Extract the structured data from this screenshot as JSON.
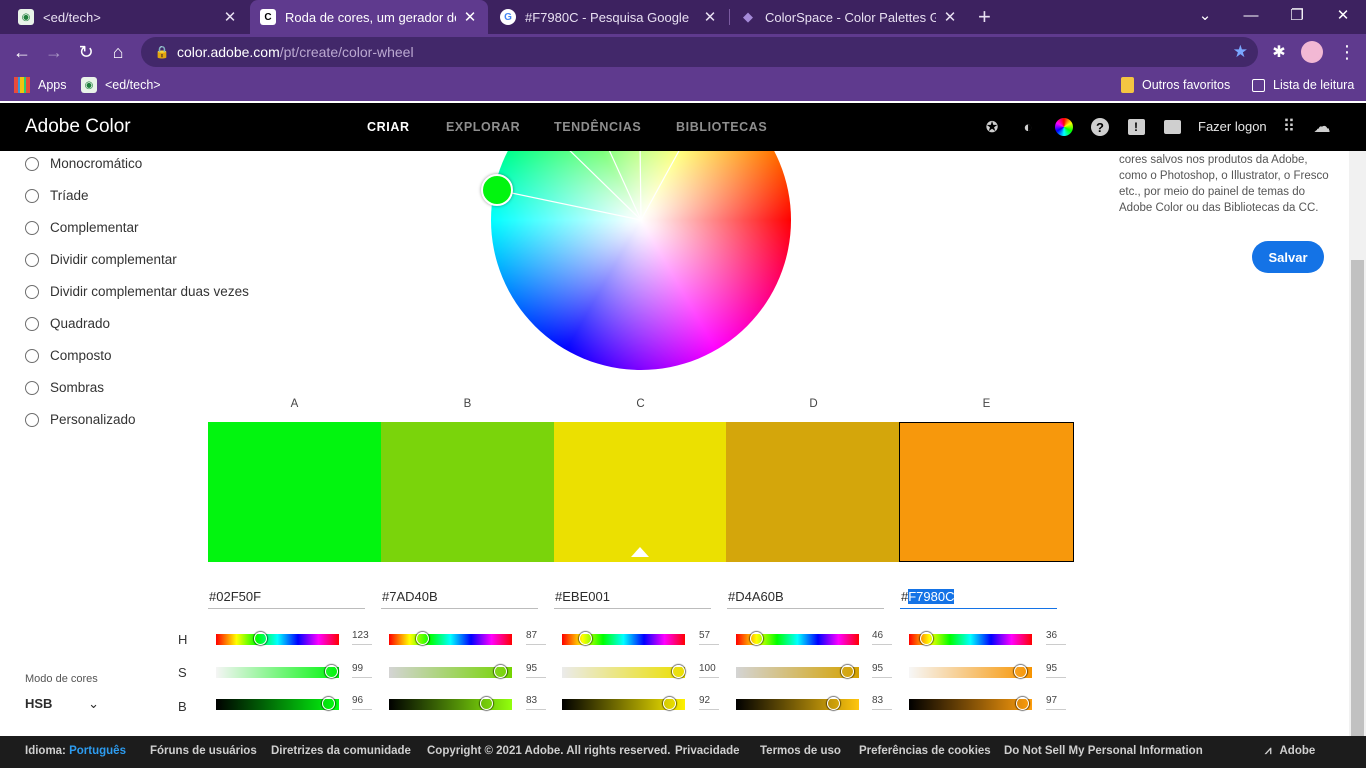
{
  "browser": {
    "tabs": [
      {
        "title": "<ed/tech>",
        "favicon": "edtech-icon",
        "active": false
      },
      {
        "title": "Roda de cores, um gerador de pa",
        "favicon": "adobe-color-icon",
        "active": true
      },
      {
        "title": "#F7980C - Pesquisa Google",
        "favicon": "google-icon",
        "active": false
      },
      {
        "title": "ColorSpace - Color Palettes Gene",
        "favicon": "colorspace-icon",
        "active": false
      }
    ],
    "new_tab": "+",
    "url_host": "color.adobe.com",
    "url_path": "/pt/create/color-wheel",
    "bookmarks": {
      "apps": "Apps",
      "edtech": "<ed/tech>",
      "other": "Outros favoritos",
      "reading_list": "Lista de leitura"
    }
  },
  "header": {
    "brand": "Adobe Color",
    "nav": [
      "CRIAR",
      "EXPLORAR",
      "TENDÊNCIAS",
      "BIBLIOTECAS"
    ],
    "active_nav": "CRIAR",
    "login": "Fazer logon"
  },
  "harmony_rules": [
    "Monocromático",
    "Tríade",
    "Complementar",
    "Dividir complementar",
    "Dividir complementar duas vezes",
    "Quadrado",
    "Composto",
    "Sombras",
    "Personalizado"
  ],
  "color_mode": {
    "label": "Modo de cores",
    "value": "HSB"
  },
  "save_panel": {
    "text": "cores salvos nos produtos da Adobe, como o Photoshop, o Illustrator, o Fresco etc., por meio do painel de temas do Adobe Color ou das Bibliotecas da CC.",
    "button": "Salvar"
  },
  "slider_labels": {
    "h": "H",
    "s": "S",
    "b": "B"
  },
  "swatches": [
    {
      "letter": "A",
      "hex": "#02F50F",
      "h": 123,
      "s": 99,
      "b": 96
    },
    {
      "letter": "B",
      "hex": "#7AD40B",
      "h": 87,
      "s": 95,
      "b": 83
    },
    {
      "letter": "C",
      "hex": "#EBE001",
      "h": 57,
      "s": 100,
      "b": 92
    },
    {
      "letter": "D",
      "hex": "#D4A60B",
      "h": 46,
      "s": 95,
      "b": 83
    },
    {
      "letter": "E",
      "hex": "#F7980C",
      "h": 36,
      "s": 95,
      "b": 97
    }
  ],
  "selected_swatch": "E",
  "footer": {
    "language_label": "Idioma:",
    "language_value": "Português",
    "links": [
      "Fóruns de usuários",
      "Diretrizes da comunidade",
      "Copyright © 2021 Adobe. All rights reserved.",
      "Privacidade",
      "Termos de uso",
      "Preferências de cookies",
      "Do Not Sell My Personal Information"
    ],
    "adobe": "Adobe"
  }
}
